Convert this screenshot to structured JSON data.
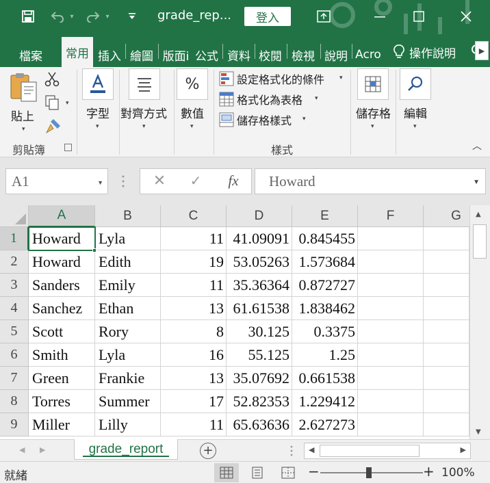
{
  "titlebar": {
    "filename": "grade_rep...",
    "login_label": "登入",
    "bg_color": "#217346"
  },
  "tabs": [
    {
      "label": "檔案"
    },
    {
      "label": "常用",
      "active": true
    },
    {
      "label": "插入"
    },
    {
      "label": "繪圖"
    },
    {
      "label": "版面i"
    },
    {
      "label": "公式"
    },
    {
      "label": "資料"
    },
    {
      "label": "校閱"
    },
    {
      "label": "檢視"
    },
    {
      "label": "說明"
    },
    {
      "label": "Acro"
    }
  ],
  "tell_me": {
    "label": "操作說明"
  },
  "ribbon": {
    "clipboard": {
      "paste_label": "貼上",
      "group_label": "剪貼簿"
    },
    "font": {
      "label": "字型"
    },
    "alignment": {
      "label": "對齊方式"
    },
    "number": {
      "label": "數值",
      "icon_text": "%"
    },
    "styles": {
      "conditional_formatting": "設定格式化的條件",
      "format_as_table": "格式化為表格",
      "cell_styles": "儲存格樣式",
      "group_label": "樣式"
    },
    "cells": {
      "label": "儲存格"
    },
    "editing": {
      "label": "編輯"
    }
  },
  "formula_bar": {
    "name_box": "A1",
    "fx_label": "fx",
    "content": "Howard"
  },
  "grid": {
    "columns": [
      "A",
      "B",
      "C",
      "D",
      "E",
      "F",
      "G"
    ],
    "rows": [
      {
        "num": "1",
        "cells": [
          "Howard",
          "Lyla",
          "11",
          "41.09091",
          "0.845455"
        ]
      },
      {
        "num": "2",
        "cells": [
          "Howard",
          "Edith",
          "19",
          "53.05263",
          "1.573684"
        ]
      },
      {
        "num": "3",
        "cells": [
          "Sanders",
          "Emily",
          "11",
          "35.36364",
          "0.872727"
        ]
      },
      {
        "num": "4",
        "cells": [
          "Sanchez",
          "Ethan",
          "13",
          "61.61538",
          "1.838462"
        ]
      },
      {
        "num": "5",
        "cells": [
          "Scott",
          "Rory",
          "8",
          "30.125",
          "0.3375"
        ]
      },
      {
        "num": "6",
        "cells": [
          "Smith",
          "Lyla",
          "16",
          "55.125",
          "1.25"
        ]
      },
      {
        "num": "7",
        "cells": [
          "Green",
          "Frankie",
          "13",
          "35.07692",
          "0.661538"
        ]
      },
      {
        "num": "8",
        "cells": [
          "Torres",
          "Summer",
          "17",
          "52.82353",
          "1.229412"
        ]
      },
      {
        "num": "9",
        "cells": [
          "Miller",
          "Lilly",
          "11",
          "65.63636",
          "2.627273"
        ]
      }
    ]
  },
  "sheet_tabs": {
    "active": "grade_report"
  },
  "statusbar": {
    "ready": "就緒",
    "zoom": "100%"
  }
}
